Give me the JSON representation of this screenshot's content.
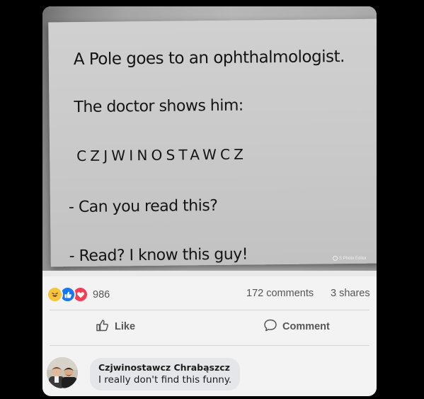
{
  "post": {
    "image_text": {
      "line1": "A Pole goes to an ophthalmologist.",
      "line2": "The doctor shows him:",
      "line3": "CZJWINOSTAWCZ",
      "line4": "- Can you read this?",
      "line5": "- Read? I know this guy!",
      "watermark": "S Photo Editor"
    },
    "stats": {
      "reaction_icons": [
        "haha-icon",
        "like-icon",
        "love-icon"
      ],
      "reaction_count": "986",
      "comments": "172 comments",
      "shares": "3 shares"
    },
    "actions": {
      "like_label": "Like",
      "comment_label": "Comment"
    },
    "comment": {
      "author": "Czjwinostawcz Chrabąszcz",
      "text": "I really don't find this funny."
    }
  },
  "colors": {
    "background": "#000000",
    "card": "#f3f3f3",
    "bubble": "#e4e6e9",
    "like_blue": "#1877f2",
    "love_red": "#f33e58",
    "haha_yellow": "#f7c43a"
  }
}
